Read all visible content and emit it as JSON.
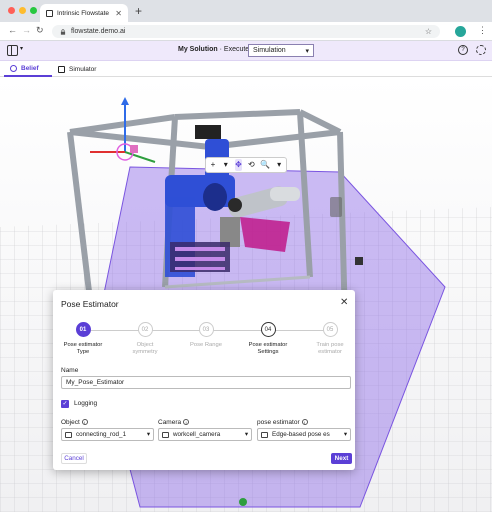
{
  "browser": {
    "tab_title": "Intrinsic Flowstate",
    "tab_close": "✕",
    "new_tab": "+",
    "url": "flowstate.demo.ai"
  },
  "app": {
    "solution_name": "My Solution",
    "execute_label": "· Execute on",
    "execute_target": "Simulation",
    "tabs": [
      {
        "label": "Belief",
        "active": true
      },
      {
        "label": "Simulator",
        "active": false
      }
    ]
  },
  "scene": {
    "toolbar": [
      "+",
      "▾",
      "✥",
      "⟲",
      "🔍",
      "▾"
    ]
  },
  "dialog": {
    "title": "Pose Estimator",
    "steps": [
      {
        "number": "01",
        "label_line1": "Pose estimator",
        "label_line2": "Type",
        "state": "active"
      },
      {
        "number": "02",
        "label_line1": "Object",
        "label_line2": "symmetry",
        "state": "todo"
      },
      {
        "number": "03",
        "label_line1": "Pose Range",
        "label_line2": "",
        "state": "todo"
      },
      {
        "number": "04",
        "label_line1": "Pose estimator",
        "label_line2": "Settings",
        "state": "current"
      },
      {
        "number": "05",
        "label_line1": "Train pose",
        "label_line2": "estimator",
        "state": "todo"
      }
    ],
    "name_label": "Name",
    "name_value": "My_Pose_Estimator",
    "logging_label": "Logging",
    "logging_checked": true,
    "object_label": "Object",
    "object_value": "connecting_rod_1",
    "camera_label": "Camera",
    "camera_value": "workcell_camera",
    "estimator_label": "pose estimator",
    "estimator_value": "Edge-based pose es",
    "cancel_label": "Cancel",
    "next_label": "Next"
  },
  "colors": {
    "accent": "#5b3fd6",
    "header_bg": "#efe9fb",
    "robot_blue": "#2f4fd6",
    "zone_purple": "#8f6be8"
  }
}
